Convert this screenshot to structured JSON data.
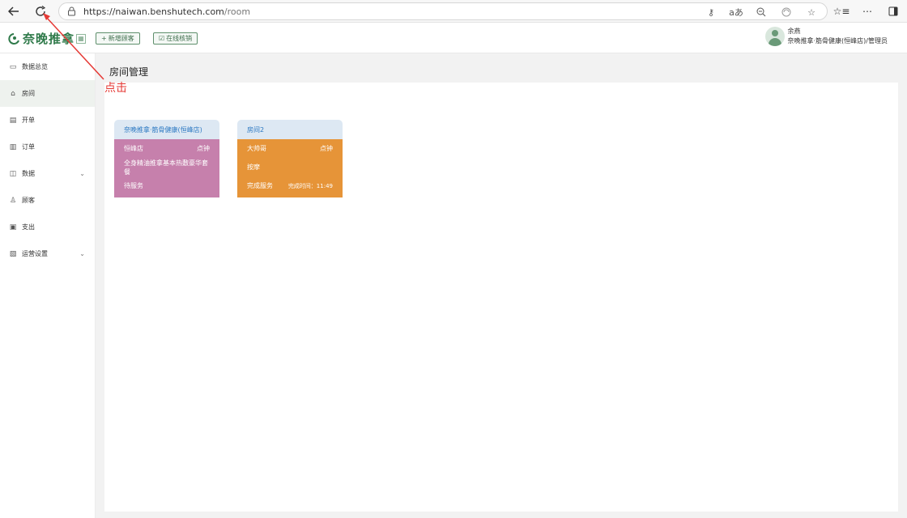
{
  "browser": {
    "url_host": "https://naiwan.benshutech.com",
    "url_path": "/room"
  },
  "header": {
    "logo_text": "奈晚推拿",
    "add_customer": "新增顾客",
    "online_verify": "在线核销",
    "user_name": "余燕",
    "user_role": "奈晚推拿·筋骨健康(恒峰店)/管理员"
  },
  "sidebar": {
    "items": [
      {
        "label": "数据总览",
        "icon": "monitor-icon"
      },
      {
        "label": "房间",
        "icon": "home-icon"
      },
      {
        "label": "开单",
        "icon": "document-icon"
      },
      {
        "label": "订单",
        "icon": "order-icon"
      },
      {
        "label": "数据",
        "icon": "data-icon"
      },
      {
        "label": "顾客",
        "icon": "user-icon"
      },
      {
        "label": "支出",
        "icon": "wallet-icon"
      },
      {
        "label": "运营设置",
        "icon": "settings-icon"
      }
    ]
  },
  "page": {
    "title": "房间管理"
  },
  "rooms": [
    {
      "name": "奈晚推拿·筋骨健康(恒峰店)",
      "color": "#c680ac",
      "rows": [
        {
          "left": "恒峰店",
          "right": "点钟"
        },
        {
          "left": "全身精油推拿基本热敷豪华套餐",
          "right": ""
        },
        {
          "left": "待服务",
          "right": ""
        }
      ]
    },
    {
      "name": "房间2",
      "color": "#e69438",
      "rows": [
        {
          "left": "大帅哥",
          "right": "点钟"
        },
        {
          "left": "按摩",
          "right": ""
        },
        {
          "left": "完成服务",
          "right": "完成时间：11:49"
        }
      ]
    }
  ],
  "annotation": {
    "label": "点击",
    "color": "#e53935"
  }
}
